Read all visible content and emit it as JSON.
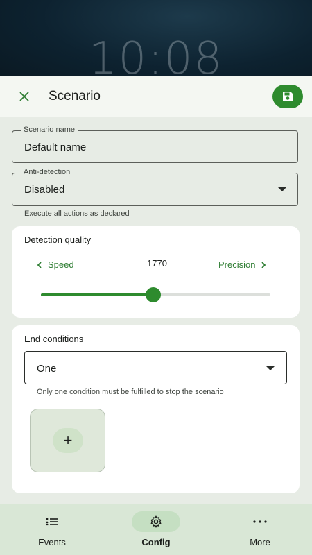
{
  "lockscreen": {
    "clock": "10:08"
  },
  "topbar": {
    "close_icon": "close-icon",
    "title": "Scenario",
    "save_icon": "save-icon"
  },
  "fields": {
    "scenario_name": {
      "label": "Scenario name",
      "value": "Default name"
    },
    "anti_detection": {
      "label": "Anti-detection",
      "value": "Disabled",
      "helper": "Execute all actions as declared"
    }
  },
  "detection_quality": {
    "title": "Detection quality",
    "left_label": "Speed",
    "right_label": "Precision",
    "value": "1770",
    "slider_fraction": 0.49
  },
  "end_conditions": {
    "title": "End conditions",
    "selected": "One",
    "helper": "Only one condition must be fulfilled to stop the scenario",
    "add_label": "+"
  },
  "bottom_nav": {
    "items": [
      {
        "label": "Events",
        "icon": "events-list-icon",
        "active": false
      },
      {
        "label": "Config",
        "icon": "gear-icon",
        "active": true
      },
      {
        "label": "More",
        "icon": "more-horizontal-icon",
        "active": false
      }
    ]
  },
  "colors": {
    "accent": "#2e8b2e",
    "sheet_background": "#e7ece5",
    "nav_background": "#d9e7d6"
  }
}
